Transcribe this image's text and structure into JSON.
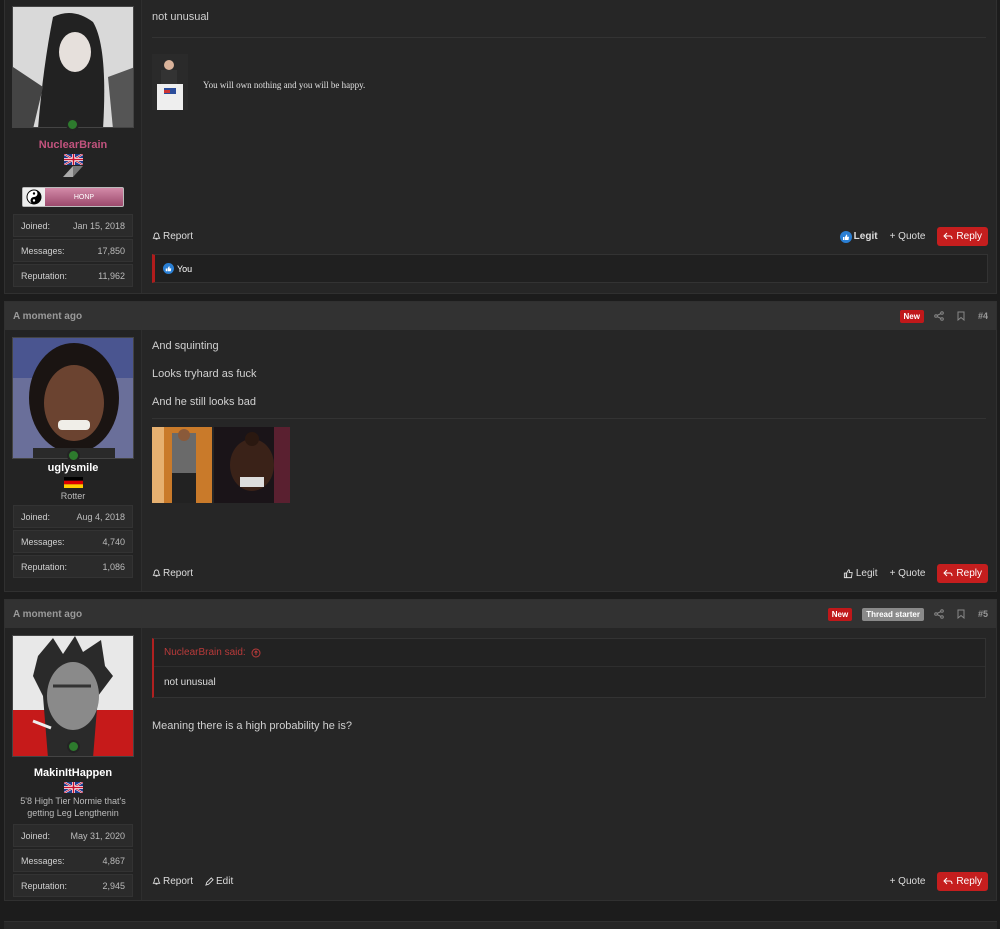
{
  "posts": [
    {
      "username": "NuclearBrain",
      "rank_label": "HONP",
      "stats": [
        {
          "label": "Joined:",
          "value": "Jan 15, 2018"
        },
        {
          "label": "Messages:",
          "value": "17,850"
        },
        {
          "label": "Reputation:",
          "value": "11,962"
        }
      ],
      "message": "not unusual",
      "signature": "You will own nothing and you will be happy.",
      "actions": {
        "report": "Report",
        "legit": "Legit",
        "quote": "+ Quote",
        "reply": "Reply"
      },
      "reactions_text": "You"
    },
    {
      "timestamp": "A moment ago",
      "badge_new": "New",
      "number": "#4",
      "username": "uglysmile",
      "user_title": "Rotter",
      "stats": [
        {
          "label": "Joined:",
          "value": "Aug 4, 2018"
        },
        {
          "label": "Messages:",
          "value": "4,740"
        },
        {
          "label": "Reputation:",
          "value": "1,086"
        }
      ],
      "lines": [
        "And squinting",
        "Looks tryhard as fuck",
        "And he still looks bad"
      ],
      "actions": {
        "report": "Report",
        "legit": "Legit",
        "quote": "+ Quote",
        "reply": "Reply"
      }
    },
    {
      "timestamp": "A moment ago",
      "badge_new": "New",
      "badge_starter": "Thread starter",
      "number": "#5",
      "username": "MakinItHappen",
      "user_title": "5'8 High Tier Normie that's getting Leg Lengthenin",
      "stats": [
        {
          "label": "Joined:",
          "value": "May 31, 2020"
        },
        {
          "label": "Messages:",
          "value": "4,867"
        },
        {
          "label": "Reputation:",
          "value": "2,945"
        }
      ],
      "quote_author": "NuclearBrain said:",
      "quote_text": "not unusual",
      "message": "Meaning there is a high probability he is?",
      "actions": {
        "report": "Report",
        "edit": "Edit",
        "quote": "+ Quote",
        "reply": "Reply"
      }
    }
  ],
  "colors": {
    "accent": "#c51e1e",
    "username_pink": "#c2537e",
    "like_blue": "#2a7fd4"
  }
}
